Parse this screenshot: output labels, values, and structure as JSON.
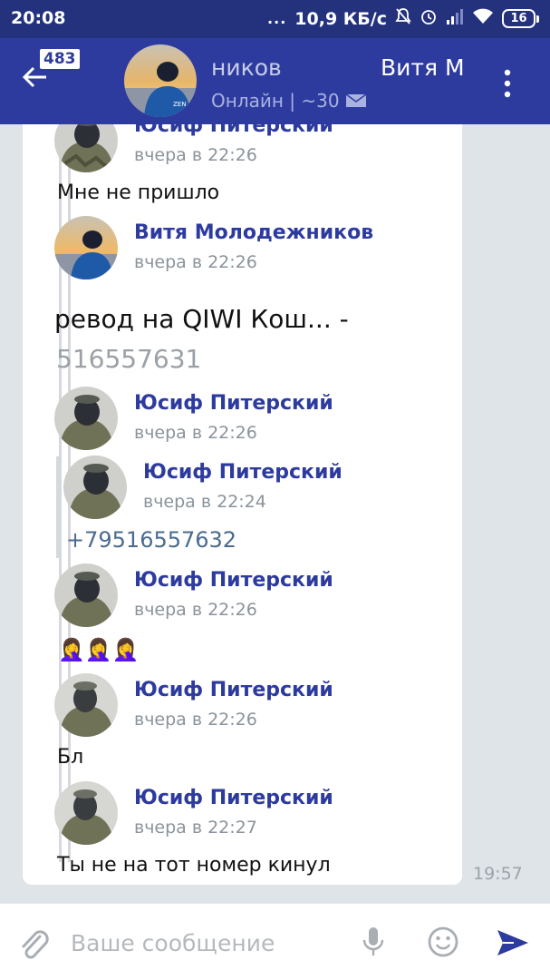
{
  "status_bar": {
    "time": "20:08",
    "dots": "...",
    "speed": "10,9 КБ/с",
    "battery": "16"
  },
  "header": {
    "badge": "483",
    "title": "ников",
    "title_second": "Витя М",
    "status": "Онлайн | ~30"
  },
  "messages": [
    {
      "name": "Юсиф Питерский",
      "date": "вчера в 22:26",
      "text": "Мне не пришло",
      "avatar": "soldier"
    },
    {
      "name": "Витя Молодежников",
      "date": "вчера в 22:26",
      "avatar": "sunset"
    },
    {
      "name": "Юсиф Питерский",
      "date": "вчера в 22:26",
      "avatar": "soldier"
    },
    {
      "name": "Юсиф Питерский",
      "date": "вчера в 22:24",
      "avatar": "soldier"
    },
    {
      "name": "Юсиф Питерский",
      "date": "вчера в 22:26",
      "avatar": "soldier"
    },
    {
      "name": "Юсиф Питерский",
      "date": "вчера в 22:26",
      "text": "Бл",
      "avatar": "soldier"
    },
    {
      "name": "Юсиф Питерский",
      "date": "вчера в 22:27",
      "text": "Ты не на тот номер кинул",
      "avatar": "soldier"
    }
  ],
  "qiwi_line": "ревод на QIWI Кош...  - ",
  "qiwi_number": "516557631",
  "phone_number": "+79516557632",
  "emoji_line": "🤦‍♀️🤦‍♀️🤦‍♀️",
  "message_time": "19:57",
  "input": {
    "placeholder": "Ваше сообщение"
  },
  "colors": {
    "status_bar": "#24327e",
    "app_bar": "#2d3b9e",
    "name_blue": "#2d3b9e",
    "background": "#dfe4e9"
  }
}
